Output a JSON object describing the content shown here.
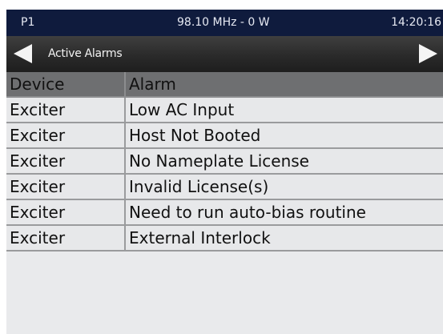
{
  "status_bar": {
    "program": "P1",
    "frequency_power": "98.10 MHz - 0 W",
    "time": "14:20:16"
  },
  "nav": {
    "title": "Active Alarms",
    "back_icon": "triangle-left-icon",
    "forward_icon": "triangle-right-icon"
  },
  "table": {
    "headers": [
      "Device",
      "Alarm"
    ],
    "rows": [
      {
        "device": "Exciter",
        "alarm": "Low AC Input"
      },
      {
        "device": "Exciter",
        "alarm": "Host Not Booted"
      },
      {
        "device": "Exciter",
        "alarm": "No Nameplate License"
      },
      {
        "device": "Exciter",
        "alarm": "Invalid License(s)"
      },
      {
        "device": "Exciter",
        "alarm": "Need to run auto-bias routine"
      },
      {
        "device": "Exciter",
        "alarm": "External Interlock"
      }
    ]
  },
  "colors": {
    "status_bar_bg": "#0f1b3d",
    "nav_bar_bg": "#2a2a2a",
    "header_bg": "#6e6f71",
    "row_bg": "#e7e8ea",
    "screen_bg": "#e9eaec"
  }
}
